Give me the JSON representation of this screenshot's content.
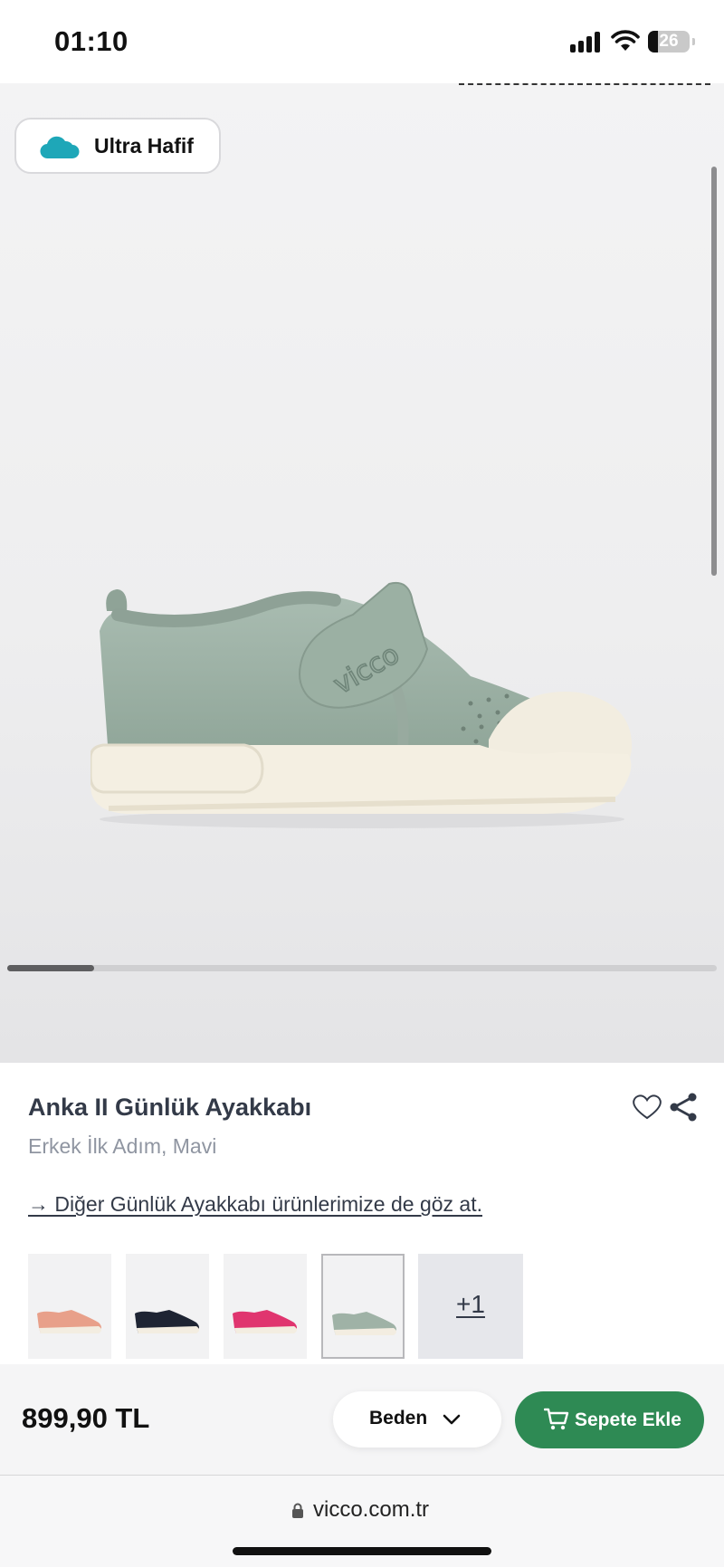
{
  "status_bar": {
    "time": "01:10",
    "battery": "26"
  },
  "badge": {
    "label": "Ultra Hafif",
    "icon": "cloud-icon",
    "icon_color": "#1ea7b8"
  },
  "product": {
    "title": "Anka II Günlük Ayakkabı",
    "subtitle": "Erkek İlk Adım, Mavi",
    "other_link": "→ Diğer Günlük Ayakkabı ürünlerimize de göz at.",
    "logo_text": "vicco",
    "swatches": [
      {
        "color_name": "pink",
        "color": "#e8a08a"
      },
      {
        "color_name": "navy",
        "color": "#1e2433"
      },
      {
        "color_name": "fuchsia",
        "color": "#e0356f"
      },
      {
        "color_name": "mint",
        "color": "#9fb2a6",
        "selected": true
      }
    ],
    "more_colors": "+1"
  },
  "bottom_bar": {
    "price": "899,90 TL",
    "size_label": "Beden",
    "add_to_cart_label": "Sepete Ekle",
    "accent_color": "#2e8a54"
  },
  "browser": {
    "url": "vicco.com.tr"
  }
}
